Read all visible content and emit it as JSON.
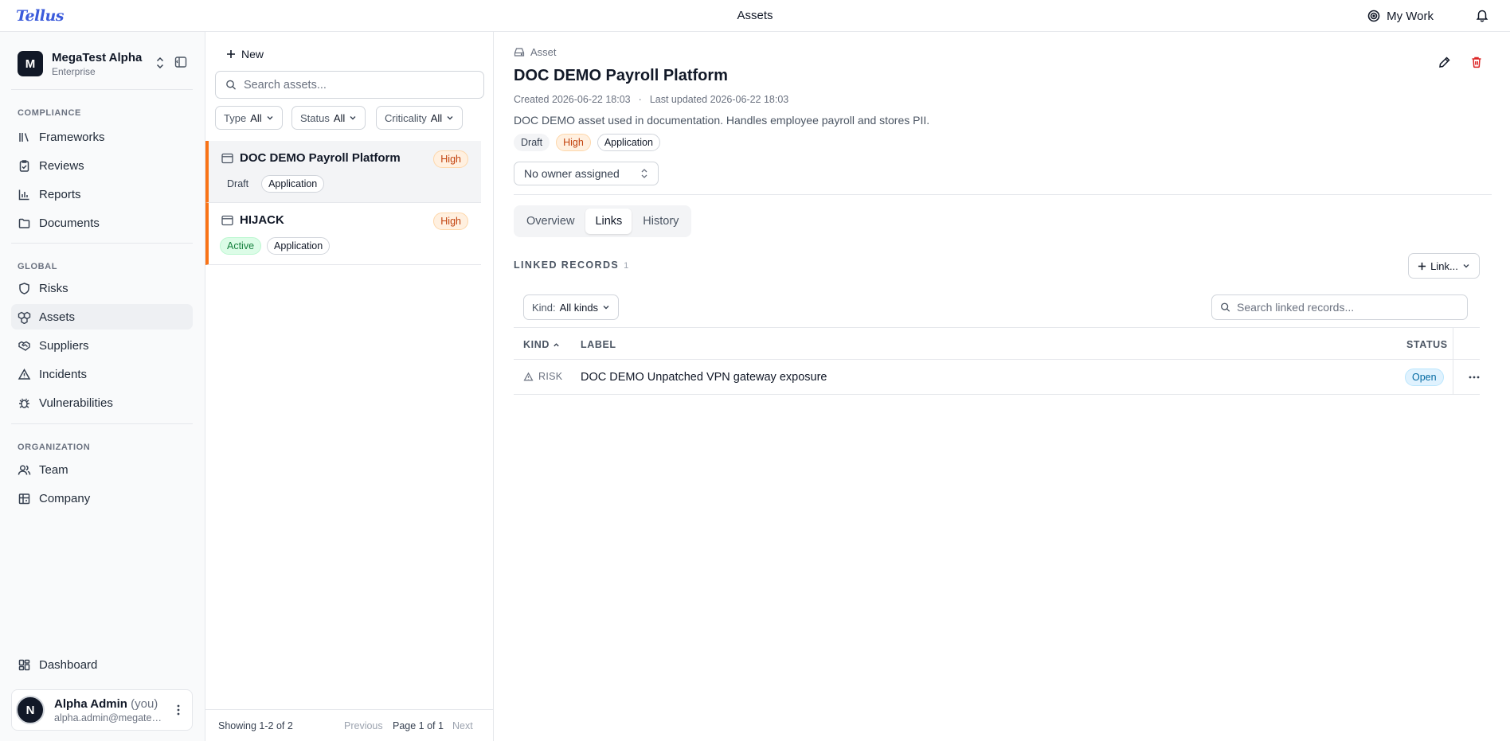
{
  "app": {
    "logo": "Tellus",
    "page_title": "Assets",
    "my_work_label": "My Work"
  },
  "sidebar": {
    "org_badge": "M",
    "org_name": "MegaTest Alpha",
    "org_plan": "Enterprise",
    "sections": {
      "compliance": "COMPLIANCE",
      "global": "GLOBAL",
      "organization": "ORGANIZATION"
    },
    "compliance_items": [
      {
        "label": "Frameworks",
        "icon": "frameworks-icon"
      },
      {
        "label": "Reviews",
        "icon": "clipboard-check-icon"
      },
      {
        "label": "Reports",
        "icon": "bar-chart-icon"
      },
      {
        "label": "Documents",
        "icon": "folder-icon"
      }
    ],
    "global_items": [
      {
        "label": "Risks",
        "icon": "shield-icon"
      },
      {
        "label": "Assets",
        "icon": "boxes-icon",
        "active": true
      },
      {
        "label": "Suppliers",
        "icon": "handshake-icon"
      },
      {
        "label": "Incidents",
        "icon": "warning-triangle-icon"
      },
      {
        "label": "Vulnerabilities",
        "icon": "bug-icon"
      }
    ],
    "organization_items": [
      {
        "label": "Team",
        "icon": "users-icon"
      },
      {
        "label": "Company",
        "icon": "building-icon"
      }
    ],
    "dashboard_label": "Dashboard",
    "user": {
      "avatar": "N",
      "name": "Alpha Admin",
      "you": "(you)",
      "email": "alpha.admin@megatest..."
    }
  },
  "list": {
    "new_label": "New",
    "search_placeholder": "Search assets...",
    "filters": [
      {
        "label": "Type",
        "value": "All"
      },
      {
        "label": "Status",
        "value": "All"
      },
      {
        "label": "Criticality",
        "value": "All"
      }
    ],
    "items": [
      {
        "title": "DOC DEMO Payroll Platform",
        "criticality": "High",
        "status": "Draft",
        "type": "Application",
        "selected": true
      },
      {
        "title": "HIJACK",
        "criticality": "High",
        "status": "Active",
        "type": "Application",
        "selected": false
      }
    ],
    "footer": {
      "showing": "Showing 1-2 of 2",
      "previous": "Previous",
      "page": "Page 1 of 1",
      "next": "Next"
    }
  },
  "detail": {
    "crumb": "Asset",
    "title": "DOC DEMO Payroll Platform",
    "created": "Created 2026-06-22 18:03",
    "meta_sep": "·",
    "updated": "Last updated 2026-06-22 18:03",
    "description": "DOC DEMO asset used in documentation. Handles employee payroll and stores PII.",
    "pills": {
      "status": "Draft",
      "criticality": "High",
      "type": "Application"
    },
    "owner": "No owner assigned",
    "tabs": [
      {
        "label": "Overview",
        "active": false
      },
      {
        "label": "Links",
        "active": true
      },
      {
        "label": "History",
        "active": false
      }
    ],
    "linked": {
      "heading": "LINKED RECORDS",
      "count": "1",
      "link_button": "Link...",
      "kind_label": "Kind:",
      "kind_value": "All kinds",
      "search_placeholder": "Search linked records...",
      "columns": {
        "kind": "KIND",
        "label": "LABEL",
        "status": "STATUS"
      },
      "rows": [
        {
          "kind": "RISK",
          "label": "DOC DEMO Unpatched VPN gateway exposure",
          "status": "Open"
        }
      ]
    }
  },
  "colors": {
    "accent": "#f97316",
    "brand": "#3b5bdb",
    "danger": "#dc2626"
  }
}
